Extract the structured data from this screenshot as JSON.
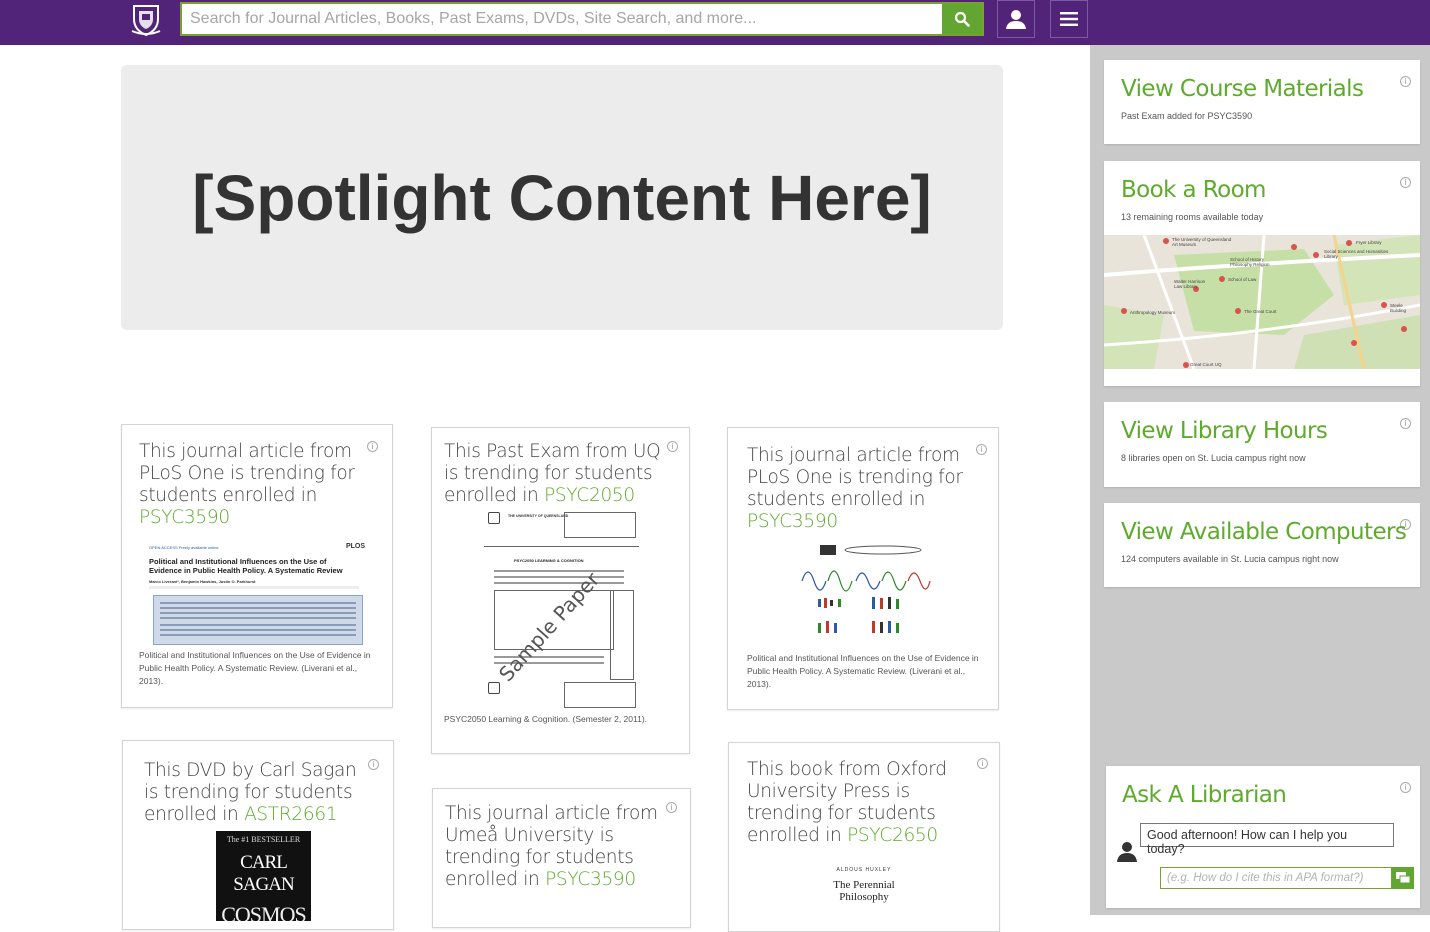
{
  "search": {
    "placeholder": "Search for Journal Articles, Books, Past Exams, DVDs, Site Search, and more..."
  },
  "spotlight": {
    "text": "[Spotlight Content Here]"
  },
  "cards": [
    {
      "prefix": "This journal article from PLoS One is trending for students enrolled in",
      "course": "PSYC3590",
      "caption": "Political and Institutional Influences on the Use of Evidence in Public Health Policy. A Systematic Review. (Liverani et al., 2013).",
      "thumb_header": "OPEN ACCESS Freely available online",
      "thumb_brand": "PLOS",
      "thumb_title": "Political and Institutional Influences on the Use of Evidence in Public Health Policy. A Systematic Review",
      "thumb_authors": "Marco Liverani*, Benjamin Hawkins, Justin O. Parkhurst"
    },
    {
      "prefix": "This Past Exam from UQ is trending for students enrolled in",
      "course": "PSYC2050",
      "caption": "PSYC2050 Learning & Cognition. (Semester 2, 2011).",
      "thumb_watermark": "Sample Paper",
      "thumb_university": "THE UNIVERSITY OF QUEENSLAND",
      "thumb_heading": "PSYC2050 LEARNING & COGNITION"
    },
    {
      "prefix": "This journal article from PLoS One is trending for students enrolled in",
      "course": "PSYC3590",
      "caption": "Political and Institutional Influences on the Use of Evidence in Public Health Policy. A Systematic Review. (Liverani et al., 2013)."
    },
    {
      "prefix": "This DVD by Carl Sagan is trending for students enrolled in",
      "course": "ASTR2661",
      "thumb_tagline": "The #1 BESTSELLER",
      "thumb_author": "CARL SAGAN",
      "thumb_title": "COSMOS"
    },
    {
      "prefix": "This journal article from Umeå University is trending for students enrolled in",
      "course": "PSYC3590"
    },
    {
      "prefix": "This book from Oxford University Press is trending for students enrolled in",
      "course": "PSYC2650",
      "thumb_author": "ALDOUS HUXLEY",
      "thumb_title": "The Perennial Philosophy"
    }
  ],
  "sidebar": {
    "course_materials": {
      "title": "View Course Materials",
      "sub": "Past Exam added for PSYC3590"
    },
    "book_room": {
      "title": "Book a Room",
      "sub": "13 remaining rooms available today",
      "map_labels": [
        "The University of Queensland Art Museum",
        "Fryer Library",
        "Social Sciences and Humanities Library",
        "School of History Philosophy Religion",
        "Walter Harrison Law Library",
        "School of Law",
        "The Great Court",
        "Steele Building",
        "Anthropology Museum",
        "Great Court UQ"
      ]
    },
    "library_hours": {
      "title": "View Library Hours",
      "sub": "8 libraries open on St. Lucia campus right now"
    },
    "computers": {
      "title": "View Available Computers",
      "sub": "124 computers available in St. Lucia campus right now"
    },
    "ask": {
      "title": "Ask A Librarian",
      "greeting": "Good afternoon! How can I help you today?",
      "placeholder": "(e.g. How do I cite this in APA format?)"
    }
  },
  "colors": {
    "brand_purple": "#51247a",
    "accent_green": "#5eab2c",
    "sidebar_grey": "#c9c9c9"
  }
}
